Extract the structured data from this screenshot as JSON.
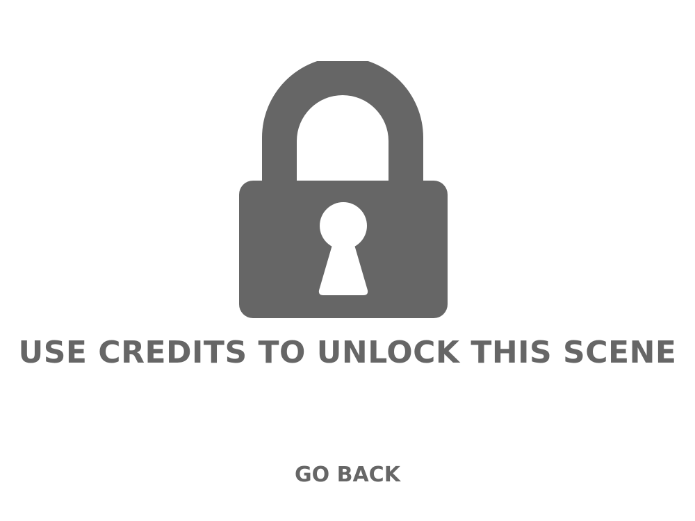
{
  "lock_screen": {
    "icon": "lock-icon",
    "message": "USE CREDITS TO UNLOCK THIS SCENE",
    "go_back_label": "GO BACK"
  },
  "colors": {
    "icon": "#666666",
    "text": "#666666",
    "background": "#ffffff"
  }
}
